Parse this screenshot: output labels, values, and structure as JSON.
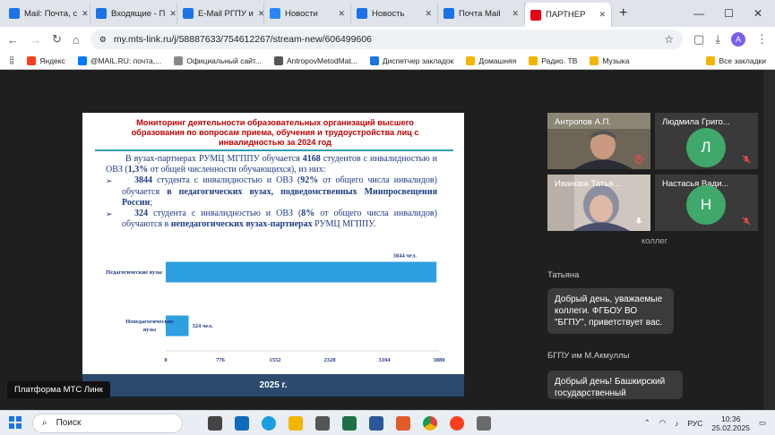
{
  "browser": {
    "tabs": [
      {
        "label": "Mail: Почта, с",
        "icon": "mail-icon",
        "color": "#1a73e8"
      },
      {
        "label": "Входящие - П",
        "icon": "mail-icon",
        "color": "#1a73e8"
      },
      {
        "label": "E-Mail РГПУ и",
        "icon": "mail-icon",
        "color": "#1a73e8"
      },
      {
        "label": "Новости",
        "icon": "vk-icon",
        "color": "#2787f5"
      },
      {
        "label": "Новость",
        "icon": "page-icon",
        "color": "#1a73e8"
      },
      {
        "label": "Почта Mail",
        "icon": "mail-icon",
        "color": "#1a73e8"
      },
      {
        "label": "ПАРТНЕР",
        "icon": "mts-icon",
        "color": "#e30613"
      }
    ],
    "url": "my.mts-link.ru/j/58887633/754612267/stream-new/606499606",
    "bookmarks": [
      {
        "label": "Яндекс",
        "color": "#fc3f1d"
      },
      {
        "label": "@MAIL.RU: почта,...",
        "color": "#0077ff"
      },
      {
        "label": "Официальный сайт...",
        "color": "#888888"
      },
      {
        "label": "AntropovMetodMat...",
        "color": "#555555"
      },
      {
        "label": "Диспетчер закладок",
        "color": "#1a73e8"
      },
      {
        "label": "Домашняя",
        "color": "#f2b600"
      },
      {
        "label": "Радио. ТВ",
        "color": "#f2b600"
      },
      {
        "label": "Музыка",
        "color": "#f2b600"
      }
    ],
    "bookmarks_all": "Все закладки"
  },
  "slide": {
    "title": "Мониторинг деятельности образовательных организаций высшего образования по вопросам приема, обучения и трудоустройства лиц с инвалидностью за 2024 год",
    "intro_pre": "В вузах-партнерах РУМЦ МГППУ обучается ",
    "intro_num": "4168",
    "intro_mid": " студентов с инвалидностью и ОВЗ (",
    "intro_pct": "1,3%",
    "intro_post": " от общей численности обучающихся), из них:",
    "b1_num": "3844",
    "b1_mid": " студента с инвалидностью и ОВЗ (",
    "b1_pct": "92%",
    "b1_mid2": " от общего числа инвалидов) обучается ",
    "b1_bold": "в педагогических вузах, подведомственных Минпросвещения России",
    "b1_end": ";",
    "b2_num": "324",
    "b2_mid": " студента с инвалидностью и ОВЗ (",
    "b2_pct": "8%",
    "b2_mid2": " от общего числа инвалидов) обучаются в ",
    "b2_bold": "непедагогических вузах-партнерах",
    "b2_end": " РУМЦ МГППУ.",
    "footer": "2025 г."
  },
  "chart_data": {
    "type": "bar",
    "orientation": "horizontal",
    "categories": [
      "Педагогические вузы",
      "Непедагогические вузы"
    ],
    "values": [
      3844,
      324
    ],
    "data_labels": [
      "3844 чел.",
      "324 чел."
    ],
    "xlim": [
      0,
      3880
    ],
    "xticks": [
      "0",
      "776",
      "1552",
      "2328",
      "3104",
      "3880"
    ],
    "color": "#2e9fe0"
  },
  "participants": [
    {
      "name": "Антропов А.П.",
      "type": "video",
      "mic": "on"
    },
    {
      "name": "Людмила Григо...",
      "type": "avatar",
      "initial": "Л",
      "mic": "muted"
    },
    {
      "name": "Иванова Татья...",
      "type": "video",
      "mic": "on"
    },
    {
      "name": "Настасья Вади...",
      "type": "avatar",
      "initial": "Н",
      "mic": "muted"
    }
  ],
  "chat": {
    "partial_text": "коллег",
    "messages": [
      {
        "author": "Татьяна",
        "text": "Добрый день, уважаемые коллеги. ФГБОУ ВО \"БГПУ\", приветствует вас."
      },
      {
        "author": "БГПУ им М.Акмуллы",
        "text": "Добрый день! Башкирский государственный"
      }
    ]
  },
  "tooltip": "Платформа МТС Линк",
  "taskbar": {
    "search_placeholder": "Поиск",
    "lang": "РУС",
    "time": "10:36",
    "date": "25.02.2025"
  }
}
